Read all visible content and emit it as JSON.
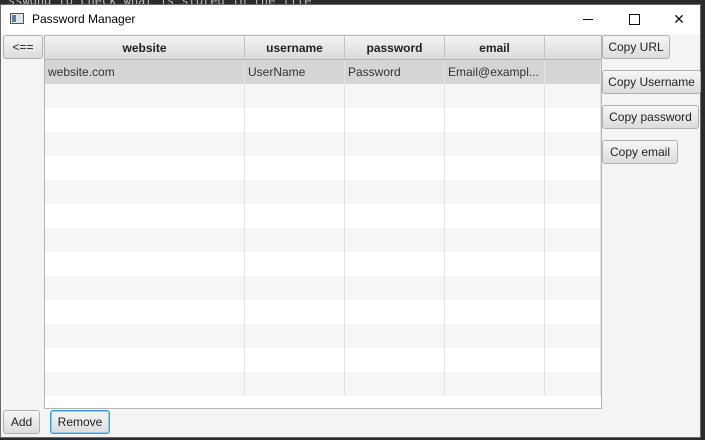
{
  "background": {
    "line1": "sswond to check what is stored in the file"
  },
  "window": {
    "title": "Password Manager",
    "controls": {
      "minimize": "—",
      "maximize": "☐",
      "close": "✕"
    }
  },
  "left": {
    "back_label": "<=="
  },
  "table": {
    "columns": [
      "website",
      "username",
      "password",
      "email",
      ""
    ],
    "rows": [
      [
        "website.com",
        "UserName",
        "Password",
        "Email@exampl...",
        ""
      ]
    ],
    "empty_rows": 13
  },
  "side_buttons": {
    "copy_url": "Copy URL",
    "copy_username": "Copy Username",
    "copy_password": "Copy password",
    "copy_email": "Copy email"
  },
  "bottom_buttons": {
    "add": "Add",
    "remove": "Remove"
  },
  "colors": {
    "selected_row": "#d5d5d5",
    "focus_border": "#3a9bd9"
  }
}
